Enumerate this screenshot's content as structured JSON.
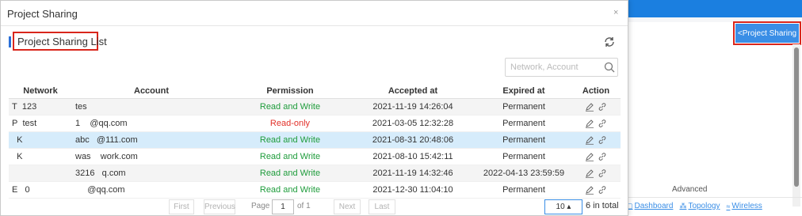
{
  "background": {
    "share_button": "<Project Sharing",
    "advanced_label": "Advanced",
    "links": [
      {
        "label": "Dashboard",
        "icon": "dashboard-icon"
      },
      {
        "label": "Topology",
        "icon": "topology-icon"
      },
      {
        "label": "Wireless",
        "icon": "wifi-icon"
      }
    ]
  },
  "modal": {
    "title": "Project Sharing",
    "close_glyph": "×",
    "list_title": "Project Sharing List",
    "search_placeholder": "Network, Account"
  },
  "table": {
    "headers": [
      "Network",
      "Account",
      "Permission",
      "Accepted at",
      "Expired at",
      "Action"
    ],
    "rows": [
      {
        "network": "T  123",
        "account": "tes",
        "permission": "Read and Write",
        "accepted": "2021-11-19 14:26:04",
        "expired": "Permanent"
      },
      {
        "network": "P  test",
        "account": "1    @qq.com",
        "permission": "Read-only",
        "accepted": "2021-03-05 12:32:28",
        "expired": "Permanent"
      },
      {
        "network": "  K",
        "account": "abc   @111.com",
        "permission": "Read and Write",
        "accepted": "2021-08-31 20:48:06",
        "expired": "Permanent"
      },
      {
        "network": "  K",
        "account": "was    work.com",
        "permission": "Read and Write",
        "accepted": "2021-08-10 15:42:11",
        "expired": "Permanent"
      },
      {
        "network": "",
        "account": "3216   q.com",
        "permission": "Read and Write",
        "accepted": "2021-11-19 14:32:46",
        "expired": "2022-04-13 23:59:59"
      },
      {
        "network": "E   0",
        "account": "     @qq.com",
        "permission": "Read and Write",
        "accepted": "2021-12-30 11:04:10",
        "expired": "Permanent"
      }
    ]
  },
  "pager": {
    "first": "First",
    "previous": "Previous",
    "page_label": "Page",
    "page_value": "1",
    "of_label": "of 1",
    "next": "Next",
    "last": "Last",
    "page_size": "10 ▴",
    "total": "6 in total"
  },
  "colors": {
    "accent": "#3a8ee6",
    "highlight_outline": "#d9261c",
    "read_write": "#1e9c3b",
    "read_only": "#e2312a"
  }
}
